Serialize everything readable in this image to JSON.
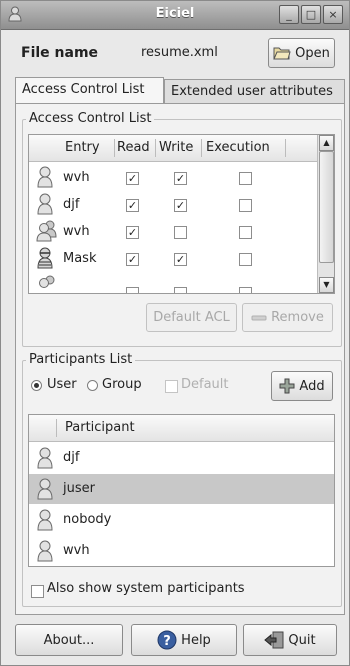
{
  "window": {
    "title": "Eiciel",
    "buttons": [
      "_",
      "□",
      "×"
    ]
  },
  "file": {
    "label": "File name",
    "value": "resume.xml",
    "open_button": "Open"
  },
  "tabs": [
    {
      "label": "Access Control List",
      "active": true
    },
    {
      "label": "Extended user attributes",
      "active": false
    }
  ],
  "acl": {
    "section_label": "Access Control List",
    "columns": [
      "Entry",
      "Read",
      "Write",
      "Execution"
    ],
    "rows": [
      {
        "entry": "wvh",
        "icon": "user-icon",
        "read": true,
        "write": true,
        "execute": false
      },
      {
        "entry": "djf",
        "icon": "user-icon",
        "read": true,
        "write": true,
        "execute": false
      },
      {
        "entry": "wvh",
        "icon": "group-icon",
        "read": true,
        "write": false,
        "execute": false
      },
      {
        "entry": "Mask",
        "icon": "mask-icon",
        "read": true,
        "write": true,
        "execute": false
      },
      {
        "entry": "",
        "icon": "group-icon",
        "read": false,
        "write": false,
        "execute": false
      }
    ],
    "default_acl_button": "Default ACL",
    "remove_button": "Remove"
  },
  "participants": {
    "section_label": "Participants List",
    "radio_user": "User",
    "radio_group": "Group",
    "default_checkbox": "Default",
    "add_button": "Add",
    "column": "Participant",
    "items": [
      {
        "name": "djf",
        "selected": false
      },
      {
        "name": "juser",
        "selected": true
      },
      {
        "name": "nobody",
        "selected": false
      },
      {
        "name": "wvh",
        "selected": false
      }
    ],
    "show_system": "Also show system participants"
  },
  "bottom": {
    "about": "About...",
    "help": "Help",
    "quit": "Quit"
  },
  "colors": {
    "selected_row": "#c8c8c8",
    "titlebar": "#9e9e9e",
    "help_icon": "#2c5aa0"
  }
}
